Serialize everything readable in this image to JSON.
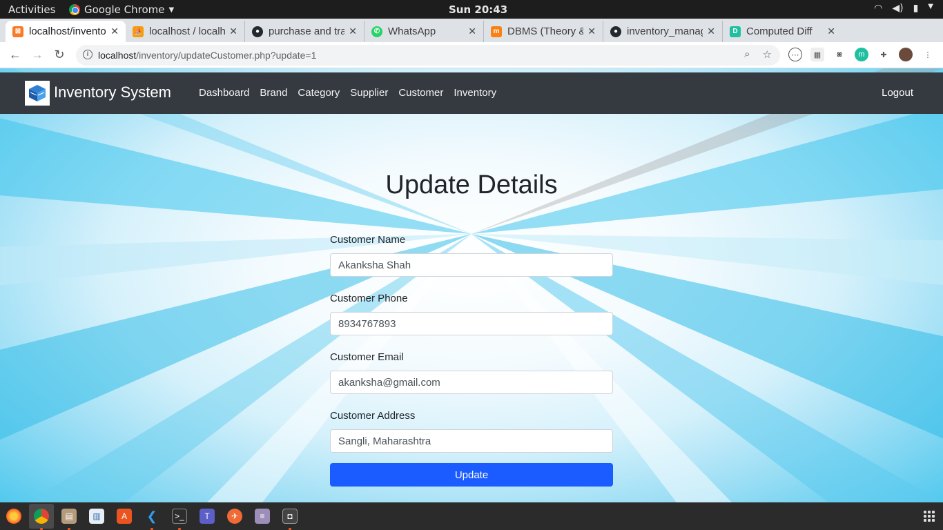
{
  "topbar": {
    "activities": "Activities",
    "app_name": "Google Chrome",
    "clock": "Sun 20:43",
    "tray_icons": [
      "wifi-icon",
      "volume-icon",
      "battery-icon",
      "menu-down-icon"
    ]
  },
  "tabs": [
    {
      "label": "localhost/inventory",
      "icon": "xampp-icon",
      "color": "#fb7a24",
      "active": true
    },
    {
      "label": "localhost / localhost",
      "icon": "phpmyadmin-icon",
      "color": "#f89c0e"
    },
    {
      "label": "purchase and transaction",
      "icon": "github-icon",
      "color": "#24292e"
    },
    {
      "label": "WhatsApp",
      "icon": "whatsapp-icon",
      "color": "#25d366"
    },
    {
      "label": "DBMS (Theory & Lab)",
      "icon": "moodle-icon",
      "color": "#f98012"
    },
    {
      "label": "inventory_management",
      "icon": "github-icon",
      "color": "#24292e"
    },
    {
      "label": "Computed Diff",
      "icon": "diff-icon",
      "color": "#1fbfa0"
    }
  ],
  "toolbar": {
    "url_host": "localhost",
    "url_path": "/inventory/updateCustomer.php?update=1"
  },
  "navbar": {
    "brand": "Inventory System",
    "links": [
      "Dashboard",
      "Brand",
      "Category",
      "Supplier",
      "Customer",
      "Inventory"
    ],
    "logout": "Logout"
  },
  "main": {
    "title": "Update Details",
    "fields": [
      {
        "label": "Customer Name",
        "value": "Akanksha Shah"
      },
      {
        "label": "Customer Phone",
        "value": "8934767893"
      },
      {
        "label": "Customer Email",
        "value": "akanksha@gmail.com"
      },
      {
        "label": "Customer Address",
        "value": "Sangli, Maharashtra"
      }
    ],
    "submit": "Update",
    "accent": "#1a5cff"
  },
  "dock": [
    "firefox-icon",
    "chrome-icon",
    "files-icon",
    "document-viewer-icon",
    "software-center-icon",
    "vscode-icon",
    "terminal-icon",
    "teams-icon",
    "postman-icon",
    "archive-manager-icon",
    "screenshot-icon"
  ]
}
